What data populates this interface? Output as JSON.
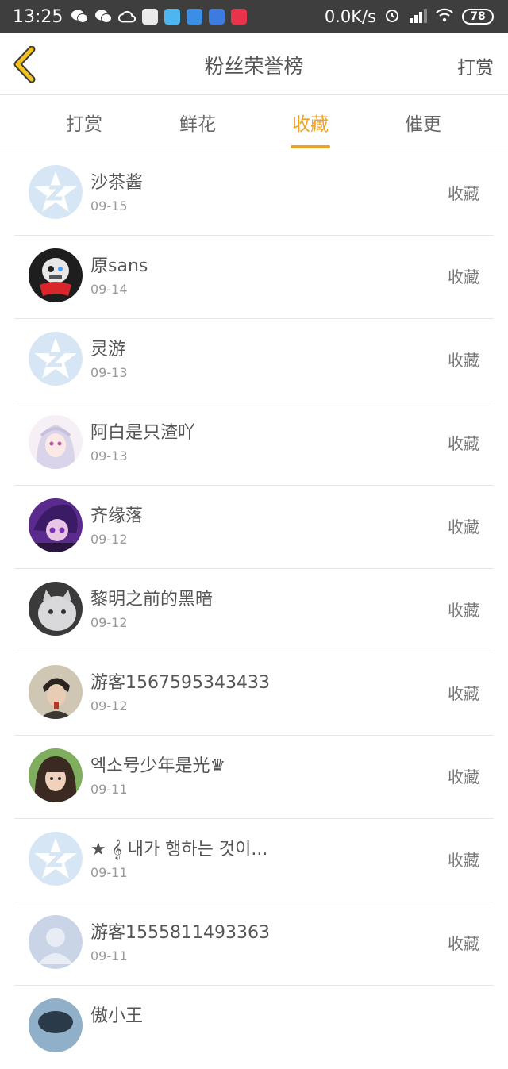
{
  "status_bar": {
    "time": "13:25",
    "net_speed": "0.0K/s",
    "battery": "78"
  },
  "header": {
    "title": "粉丝荣誉榜",
    "action": "打赏"
  },
  "tabs": [
    {
      "label": "打赏",
      "active": false
    },
    {
      "label": "鲜花",
      "active": false
    },
    {
      "label": "收藏",
      "active": true
    },
    {
      "label": "催更",
      "active": false
    }
  ],
  "colors": {
    "accent": "#f0a323",
    "status_bar": "#3e3e3e"
  },
  "fans": [
    {
      "name": "沙茶酱",
      "date": "09-15",
      "action": "收藏",
      "avatar": "default-star-avatar"
    },
    {
      "name": "原sans",
      "date": "09-14",
      "action": "收藏",
      "avatar": "photo-avatar"
    },
    {
      "name": "灵游",
      "date": "09-13",
      "action": "收藏",
      "avatar": "default-star-avatar"
    },
    {
      "name": "阿白是只渣吖",
      "date": "09-13",
      "action": "收藏",
      "avatar": "photo-avatar"
    },
    {
      "name": "齐缘落",
      "date": "09-12",
      "action": "收藏",
      "avatar": "photo-avatar"
    },
    {
      "name": "黎明之前的黑暗",
      "date": "09-12",
      "action": "收藏",
      "avatar": "photo-avatar"
    },
    {
      "name": "游客1567595343433",
      "date": "09-12",
      "action": "收藏",
      "avatar": "photo-avatar"
    },
    {
      "name": "엑소号少年是光♛",
      "date": "09-11",
      "action": "收藏",
      "avatar": "photo-avatar"
    },
    {
      "name": "★ 𝄞 내가 행하는 것이...",
      "date": "09-11",
      "action": "收藏",
      "avatar": "default-star-avatar"
    },
    {
      "name": "游客1555811493363",
      "date": "09-11",
      "action": "收藏",
      "avatar": "default-person-avatar"
    },
    {
      "name": "傲小王",
      "date": "",
      "action": "",
      "avatar": "photo-avatar"
    }
  ]
}
